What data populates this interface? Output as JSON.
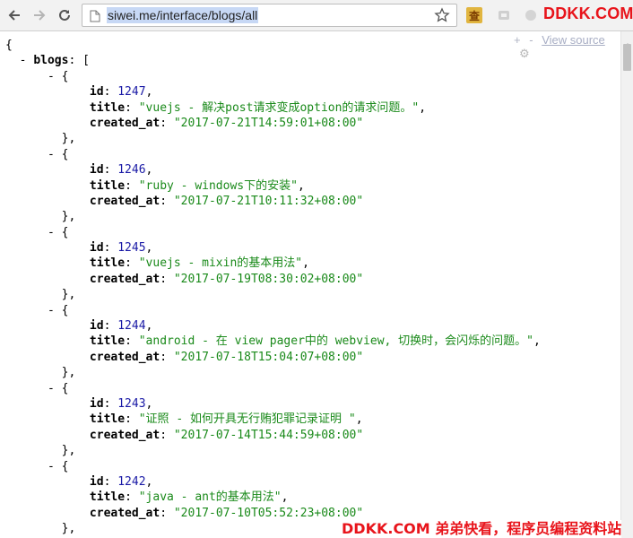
{
  "browser": {
    "url": "siwei.me/interface/blogs/all",
    "icons": {
      "back": "arrow-left-icon",
      "forward": "arrow-right-icon",
      "reload": "reload-icon",
      "page": "page-icon",
      "bookmark": "star-icon",
      "translate": "translate-extension-icon",
      "extension2": "extension-icon",
      "extension3": "extension-icon",
      "extension4": "extension-icon"
    },
    "translate_glyph": "查"
  },
  "watermarks": {
    "top": "DDKK.COM",
    "bottom": "DDKK.COM 弟弟快看，程序员编程资料站",
    "color": "#e8141b"
  },
  "viewer_controls": {
    "expand": "+",
    "collapse": "-",
    "view_source": "View source"
  },
  "json": {
    "root_key": "blogs",
    "open_brace": "{",
    "open_bracket": "[",
    "toggle": "-",
    "items": [
      {
        "id": "1247",
        "title": "\"vuejs - 解决post请求变成option的请求问题。\"",
        "created_at": "\"2017-07-21T14:59:01+08:00\""
      },
      {
        "id": "1246",
        "title": "\"ruby - windows下的安装\"",
        "created_at": "\"2017-07-21T10:11:32+08:00\""
      },
      {
        "id": "1245",
        "title": "\"vuejs - mixin的基本用法\"",
        "created_at": "\"2017-07-19T08:30:02+08:00\""
      },
      {
        "id": "1244",
        "title": "\"android - 在 view pager中的 webview, 切换时，会闪烁的问题。\"",
        "created_at": "\"2017-07-18T15:04:07+08:00\""
      },
      {
        "id": "1243",
        "title": "\"证照 - 如何开具无行贿犯罪记录证明 \"",
        "created_at": "\"2017-07-14T15:44:59+08:00\""
      },
      {
        "id": "1242",
        "title": "\"java - ant的基本用法\"",
        "created_at": "\"2017-07-10T05:52:23+08:00\""
      }
    ],
    "labels": {
      "id": "id",
      "title": "title",
      "created_at": "created_at"
    }
  }
}
